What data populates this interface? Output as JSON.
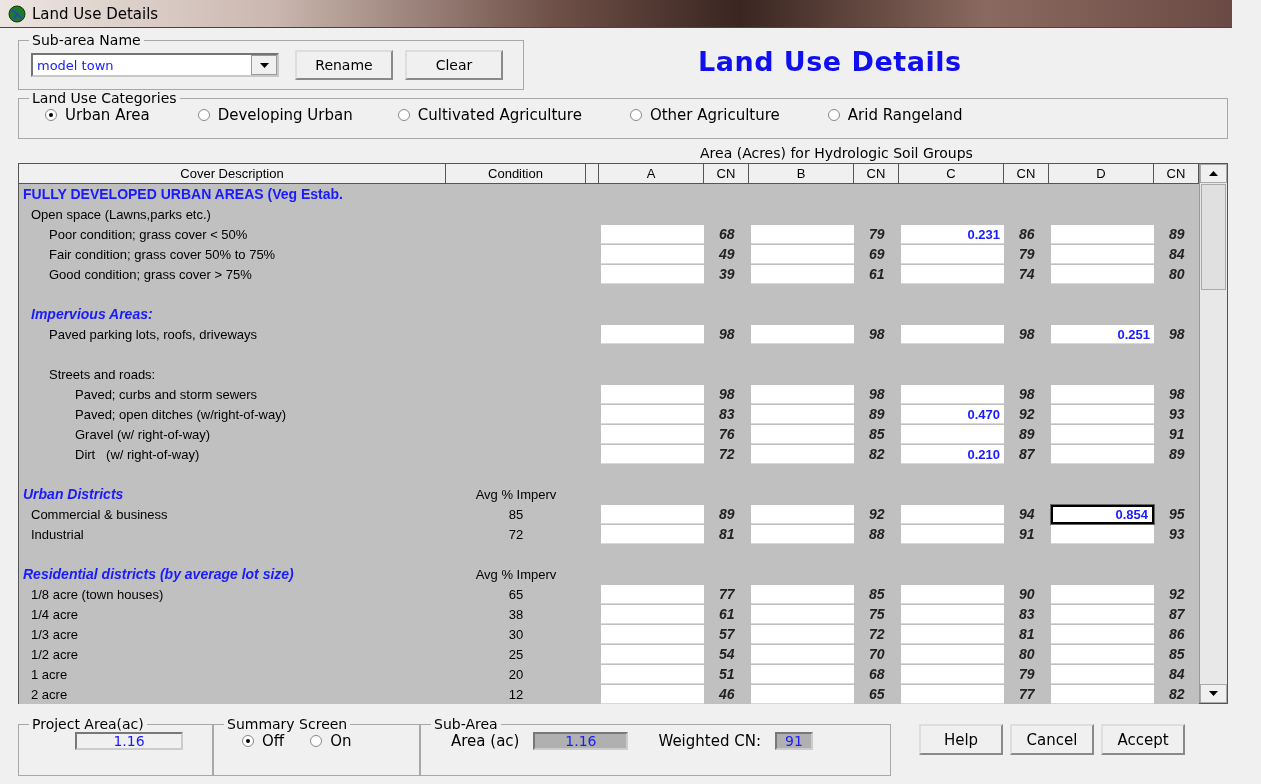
{
  "window": {
    "title": "Land Use Details"
  },
  "sub_area_name": {
    "label": "Sub-area Name",
    "value": "model town",
    "buttons": [
      "Rename",
      "Clear"
    ]
  },
  "heading": "Land Use Details",
  "categories": {
    "label": "Land Use Categories",
    "options": [
      {
        "label": "Urban Area",
        "selected": true
      },
      {
        "label": "Developing Urban",
        "selected": false
      },
      {
        "label": "Cultivated Agriculture",
        "selected": false
      },
      {
        "label": "Other Agriculture",
        "selected": false
      },
      {
        "label": "Arid Rangeland",
        "selected": false
      }
    ]
  },
  "table": {
    "group_header": "Area (Acres) for Hydrologic Soil Groups",
    "columns": [
      "Cover Description",
      "Condition",
      "A",
      "CN",
      "B",
      "CN",
      "C",
      "CN",
      "D",
      "CN"
    ],
    "rows": [
      {
        "kind": "heading",
        "text": "FULLY DEVELOPED URBAN AREAS (Veg Estab.",
        "children": [
          {
            "kind": "label",
            "text": "Open space (Lawns,parks etc.)",
            "children": [
              {
                "kind": "entry",
                "text": "Poor condition; grass cover < 50%",
                "cells": [
                  {
                    "cn": "68",
                    "focused": false
                  },
                  {
                    "cn": "79",
                    "focused": false
                  },
                  {
                    "value": "0.231",
                    "cn": "86",
                    "focused": false
                  },
                  {
                    "cn": "89",
                    "focused": false
                  }
                ]
              },
              {
                "kind": "entry",
                "text": "Fair condition; grass cover 50% to 75%",
                "cells": [
                  {
                    "cn": "49",
                    "focused": false
                  },
                  {
                    "cn": "69",
                    "focused": false
                  },
                  {
                    "cn": "79",
                    "focused": false
                  },
                  {
                    "cn": "84",
                    "focused": false
                  }
                ]
              },
              {
                "kind": "entry",
                "text": "Good condition; grass cover > 75%",
                "cells": [
                  {
                    "cn": "39",
                    "focused": false
                  },
                  {
                    "cn": "61",
                    "focused": false
                  },
                  {
                    "cn": "74",
                    "focused": false
                  },
                  {
                    "cn": "80",
                    "focused": false
                  }
                ]
              }
            ]
          },
          {
            "kind": "spacer"
          },
          {
            "kind": "subheading",
            "text": "Impervious Areas:",
            "children": [
              {
                "kind": "entry",
                "text": "Paved parking lots, roofs, driveways",
                "cells": [
                  {
                    "cn": "98",
                    "focused": false
                  },
                  {
                    "cn": "98",
                    "focused": false
                  },
                  {
                    "cn": "98",
                    "focused": false
                  },
                  {
                    "value": "0.251",
                    "cn": "98",
                    "focused": false
                  }
                ]
              },
              {
                "kind": "spacer"
              },
              {
                "kind": "label",
                "text": "Streets and roads:",
                "children": [
                  {
                    "kind": "entry",
                    "text": "Paved; curbs and storm sewers",
                    "cells": [
                      {
                        "cn": "98",
                        "focused": false
                      },
                      {
                        "cn": "98",
                        "focused": false
                      },
                      {
                        "cn": "98",
                        "focused": false
                      },
                      {
                        "cn": "98",
                        "focused": false
                      }
                    ]
                  },
                  {
                    "kind": "entry",
                    "text": "Paved; open ditches (w/right-of-way)",
                    "cells": [
                      {
                        "cn": "83",
                        "focused": false
                      },
                      {
                        "cn": "89",
                        "focused": false
                      },
                      {
                        "value": "0.470",
                        "cn": "92",
                        "focused": false
                      },
                      {
                        "cn": "93",
                        "focused": false
                      }
                    ]
                  },
                  {
                    "kind": "entry",
                    "text": "Gravel (w/ right-of-way)",
                    "cells": [
                      {
                        "cn": "76",
                        "focused": false
                      },
                      {
                        "cn": "85",
                        "focused": false
                      },
                      {
                        "cn": "89",
                        "focused": false
                      },
                      {
                        "cn": "91",
                        "focused": false
                      }
                    ]
                  },
                  {
                    "kind": "entry",
                    "text": "Dirt   (w/ right-of-way)",
                    "cells": [
                      {
                        "cn": "72",
                        "focused": false
                      },
                      {
                        "cn": "82",
                        "focused": false
                      },
                      {
                        "value": "0.210",
                        "cn": "87",
                        "focused": false
                      },
                      {
                        "cn": "89",
                        "focused": false
                      }
                    ]
                  }
                ]
              }
            ]
          }
        ]
      },
      {
        "kind": "spacer"
      },
      {
        "kind": "subheading",
        "text": "Urban Districts",
        "condition": "Avg % Imperv",
        "children": [
          {
            "kind": "entry",
            "text": "Commercial & business",
            "condition": "85",
            "cells": [
              {
                "cn": "89",
                "focused": false
              },
              {
                "cn": "92",
                "focused": false
              },
              {
                "cn": "94",
                "focused": false
              },
              {
                "value": "0.854",
                "cn": "95",
                "focused": true
              }
            ]
          },
          {
            "kind": "entry",
            "text": "Industrial",
            "condition": "72",
            "cells": [
              {
                "cn": "81",
                "focused": false
              },
              {
                "cn": "88",
                "focused": false
              },
              {
                "cn": "91",
                "focused": false
              },
              {
                "cn": "93",
                "focused": false
              }
            ]
          }
        ]
      },
      {
        "kind": "spacer"
      },
      {
        "kind": "subheading",
        "text": "Residential districts (by average lot size)",
        "condition": "Avg % Imperv",
        "children": [
          {
            "kind": "entry",
            "text": "1/8 acre (town houses)",
            "condition": "65",
            "cells": [
              {
                "cn": "77",
                "focused": false
              },
              {
                "cn": "85",
                "focused": false
              },
              {
                "cn": "90",
                "focused": false
              },
              {
                "cn": "92",
                "focused": false
              }
            ]
          },
          {
            "kind": "entry",
            "text": "1/4 acre",
            "condition": "38",
            "cells": [
              {
                "cn": "61",
                "focused": false
              },
              {
                "cn": "75",
                "focused": false
              },
              {
                "cn": "83",
                "focused": false
              },
              {
                "cn": "87",
                "focused": false
              }
            ]
          },
          {
            "kind": "entry",
            "text": "1/3 acre",
            "condition": "30",
            "cells": [
              {
                "cn": "57",
                "focused": false
              },
              {
                "cn": "72",
                "focused": false
              },
              {
                "cn": "81",
                "focused": false
              },
              {
                "cn": "86",
                "focused": false
              }
            ]
          },
          {
            "kind": "entry",
            "text": "1/2 acre",
            "condition": "25",
            "cells": [
              {
                "cn": "54",
                "focused": false
              },
              {
                "cn": "70",
                "focused": false
              },
              {
                "cn": "80",
                "focused": false
              },
              {
                "cn": "85",
                "focused": false
              }
            ]
          },
          {
            "kind": "entry",
            "text": "1 acre",
            "condition": "20",
            "cells": [
              {
                "cn": "51",
                "focused": false
              },
              {
                "cn": "68",
                "focused": false
              },
              {
                "cn": "79",
                "focused": false
              },
              {
                "cn": "84",
                "focused": false
              }
            ]
          },
          {
            "kind": "entry",
            "text": "2 acre",
            "condition": "12",
            "cells": [
              {
                "cn": "46",
                "focused": false
              },
              {
                "cn": "65",
                "focused": false
              },
              {
                "cn": "77",
                "focused": false
              },
              {
                "cn": "82",
                "focused": false
              }
            ]
          }
        ]
      }
    ]
  },
  "project_area": {
    "label": "Project Area(ac)",
    "value": "1.16"
  },
  "summary_screen": {
    "label": "Summary Screen",
    "options": [
      {
        "label": "Off",
        "selected": true
      },
      {
        "label": "On",
        "selected": false
      }
    ]
  },
  "sub_area": {
    "label": "Sub-Area",
    "area_label": "Area (ac)",
    "area_value": "1.16",
    "cn_label": "Weighted CN:",
    "cn_value": "91"
  },
  "buttons": [
    "Help",
    "Cancel",
    "Accept"
  ]
}
